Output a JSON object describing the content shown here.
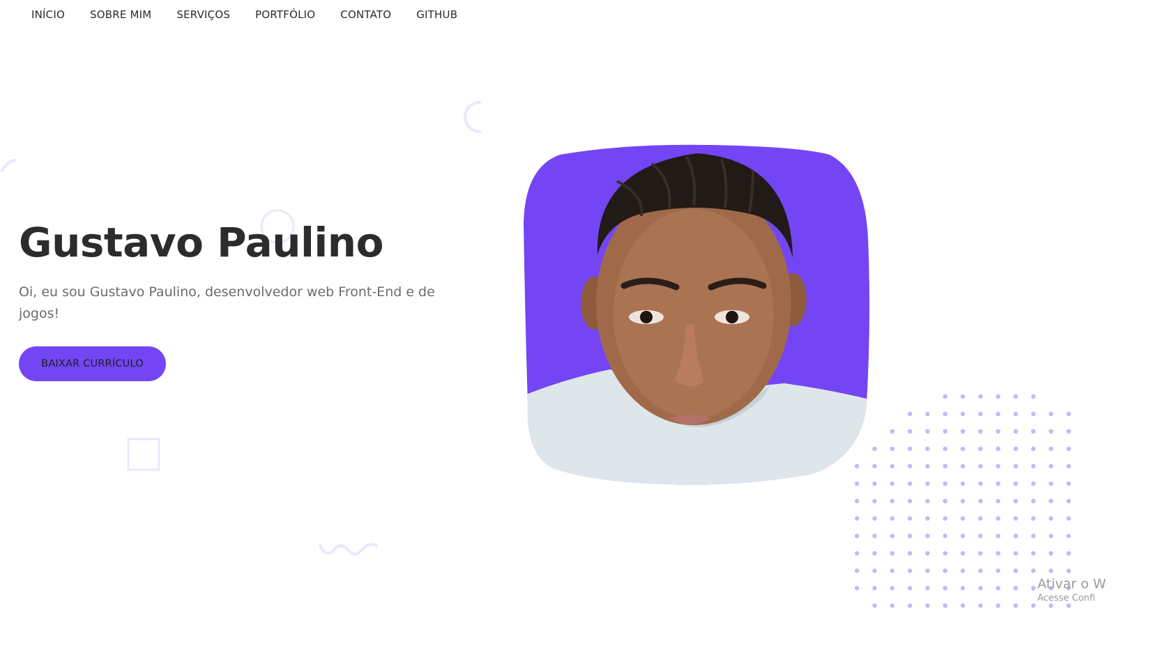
{
  "nav": {
    "items": [
      {
        "label": "INÍCIO"
      },
      {
        "label": "SOBRE MIM"
      },
      {
        "label": "SERVIÇOS"
      },
      {
        "label": "PORTFÓLIO"
      },
      {
        "label": "CONTATO"
      },
      {
        "label": "GITHUB"
      }
    ]
  },
  "hero": {
    "title": "Gustavo Paulino",
    "subtitle": "Oi, eu sou Gustavo Paulino, desenvolvedor web Front-End e de jogos!",
    "button_label": "BAIXAR CURRÍCULO"
  },
  "profile_photo": {
    "subject": "portrait of Gustavo Paulino"
  },
  "watermark": {
    "line1": "Ativar o W",
    "line2": "Acesse Confi"
  },
  "colors": {
    "accent": "#7445f5",
    "title_text": "#2c2c2c",
    "body_text": "#6b6b6b",
    "decor": "#ece6fd",
    "dots": "#c7b6fb"
  }
}
